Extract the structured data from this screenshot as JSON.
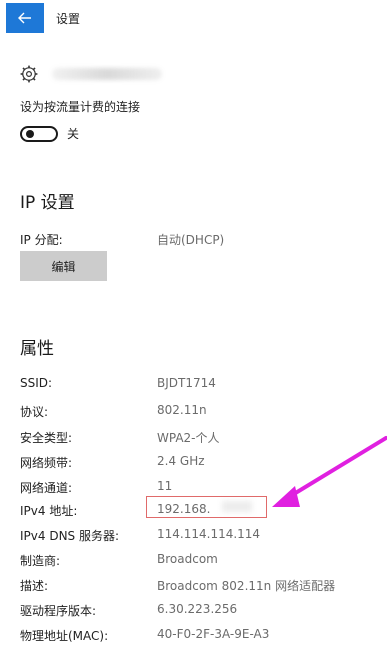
{
  "header": {
    "title": "设置"
  },
  "metered": {
    "label": "设为按流量计费的连接",
    "toggle_state": "关"
  },
  "ip_settings": {
    "heading": "IP 设置",
    "assignment_label": "IP 分配:",
    "assignment_value": "自动(DHCP)",
    "edit_label": "编辑"
  },
  "properties": {
    "heading": "属性",
    "rows": [
      {
        "label": "SSID:",
        "value": "BJDT1714"
      },
      {
        "label": "协议:",
        "value": "802.11n"
      },
      {
        "label": "安全类型:",
        "value": "WPA2-个人"
      },
      {
        "label": "网络频带:",
        "value": "2.4 GHz"
      },
      {
        "label": "网络通道:",
        "value": "11"
      },
      {
        "label": "IPv4 地址:",
        "value": "192.168."
      },
      {
        "label": "IPv4 DNS 服务器:",
        "value": "114.114.114.114"
      },
      {
        "label": "制造商:",
        "value": "Broadcom"
      },
      {
        "label": "描述:",
        "value": "Broadcom 802.11n 网络适配器"
      },
      {
        "label": "驱动程序版本:",
        "value": "6.30.223.256"
      },
      {
        "label": "物理地址(MAC):",
        "value": "40-F0-2F-3A-9E-A3"
      }
    ]
  },
  "colors": {
    "accent": "#1e78d7",
    "highlight_box": "#e06a6a",
    "annotation_arrow": "#e020e0"
  },
  "icons": {
    "back": "back-arrow-icon",
    "network": "gear-icon"
  }
}
